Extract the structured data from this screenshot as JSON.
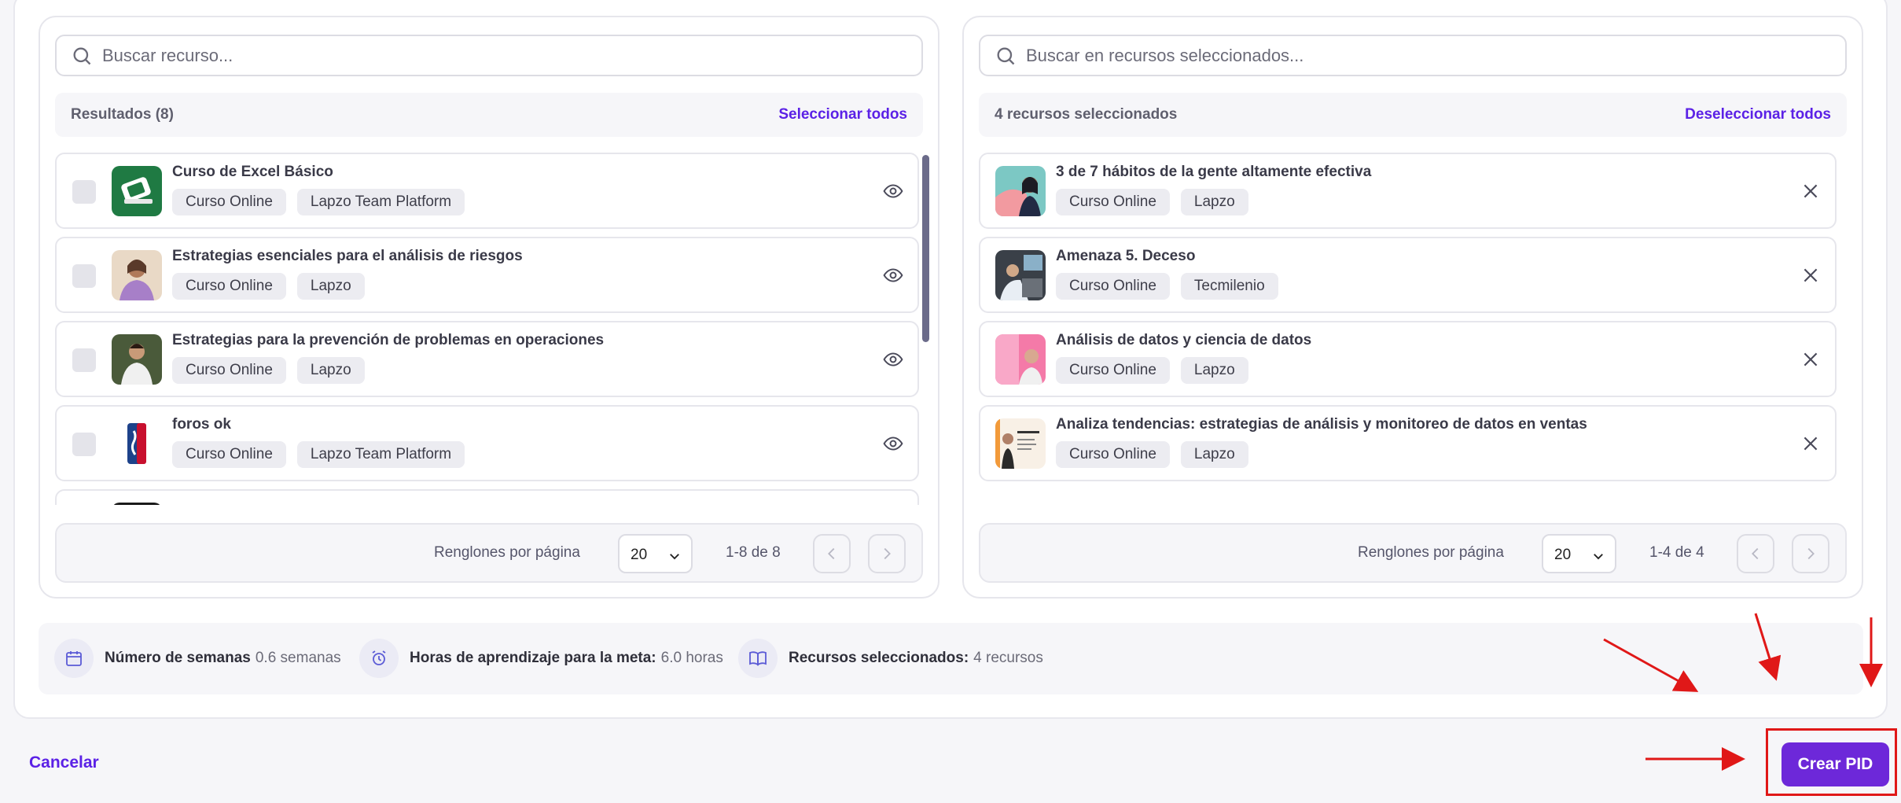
{
  "left": {
    "search_placeholder": "Buscar recurso...",
    "count": "Resultados (8)",
    "action": "Seleccionar todos",
    "items": [
      {
        "title": "Curso de Excel Básico",
        "tags": [
          "Curso Online",
          "Lapzo Team Platform"
        ]
      },
      {
        "title": "Estrategias esenciales para el análisis de riesgos",
        "tags": [
          "Curso Online",
          "Lapzo"
        ]
      },
      {
        "title": "Estrategias para la prevención de problemas en operaciones",
        "tags": [
          "Curso Online",
          "Lapzo"
        ]
      },
      {
        "title": "foros ok",
        "tags": [
          "Curso Online",
          "Lapzo Team Platform"
        ]
      }
    ],
    "rows_label": "Renglones por página",
    "rows_value": "20",
    "range": "1-8 de 8"
  },
  "right": {
    "search_placeholder": "Buscar en recursos seleccionados...",
    "count": "4 recursos seleccionados",
    "action": "Deseleccionar todos",
    "items": [
      {
        "title": "3 de 7 hábitos de la gente altamente efectiva",
        "tags": [
          "Curso Online",
          "Lapzo"
        ]
      },
      {
        "title": "Amenaza 5. Deceso",
        "tags": [
          "Curso Online",
          "Tecmilenio"
        ]
      },
      {
        "title": "Análisis de datos y ciencia de datos",
        "tags": [
          "Curso Online",
          "Lapzo"
        ]
      },
      {
        "title": "Analiza tendencias: estrategias de análisis y monitoreo de datos en ventas",
        "tags": [
          "Curso Online",
          "Lapzo"
        ]
      }
    ],
    "rows_label": "Renglones por página",
    "rows_value": "20",
    "range": "1-4 de 4"
  },
  "stats": {
    "weeks_label": "Número de semanas",
    "weeks_value": "0.6 semanas",
    "hours_label": "Horas de aprendizaje para la meta:",
    "hours_value": "6.0 horas",
    "resources_label": "Recursos seleccionados:",
    "resources_value": "4 recursos"
  },
  "footer": {
    "cancel": "Cancelar",
    "create": "Crear PID"
  },
  "colors": {
    "accent": "#5b21e6",
    "primary_button": "#6d28d9",
    "annotation": "#e01818"
  },
  "icons": [
    "search-icon",
    "eye-icon",
    "close-icon",
    "chevron-down-icon",
    "chevron-left-icon",
    "chevron-right-icon",
    "calendar-icon",
    "alarm-clock-icon",
    "book-icon"
  ]
}
